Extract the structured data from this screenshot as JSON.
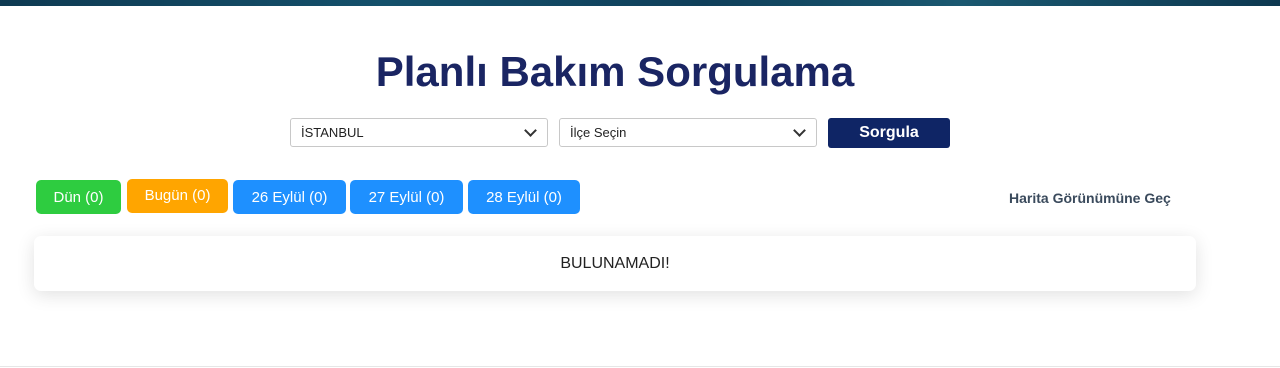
{
  "header": {
    "title": "Planlı Bakım Sorgulama"
  },
  "filters": {
    "city_selected": "İSTANBUL",
    "district_selected": "İlçe Seçin",
    "query_label": "Sorgula"
  },
  "tabs": [
    {
      "label": "Dün (0)",
      "color": "#2ecc40"
    },
    {
      "label": "Bugün (0)",
      "color": "#ffa500"
    },
    {
      "label": "26 Eylül (0)",
      "color": "#1e90ff"
    },
    {
      "label": "27 Eylül (0)",
      "color": "#1e90ff"
    },
    {
      "label": "28 Eylül (0)",
      "color": "#1e90ff"
    }
  ],
  "map_link": "Harita Görünümüne Geç",
  "result": {
    "message": "BULUNAMADI!"
  },
  "colors": {
    "title": "#1a2563",
    "primary_button": "#0f2565"
  }
}
